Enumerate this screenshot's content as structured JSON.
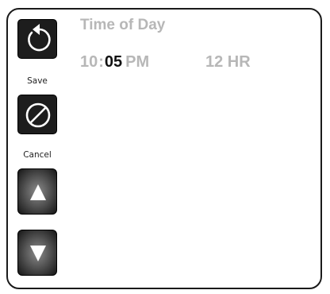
{
  "title": "Time of Day",
  "time": {
    "hour": "10",
    "separator": ":",
    "minutes": "05",
    "ampm": "PM"
  },
  "format": "12 HR",
  "buttons": {
    "save_label": "Save",
    "cancel_label": "Cancel"
  },
  "icons": {
    "save": "undo-arrow-icon",
    "cancel": "cancel-circle-icon",
    "up": "triangle-up-icon",
    "down": "triangle-down-icon"
  },
  "colors": {
    "inactive_text": "#b7b7b7",
    "active_text": "#111111",
    "button_dark": "#1d1d1d"
  }
}
